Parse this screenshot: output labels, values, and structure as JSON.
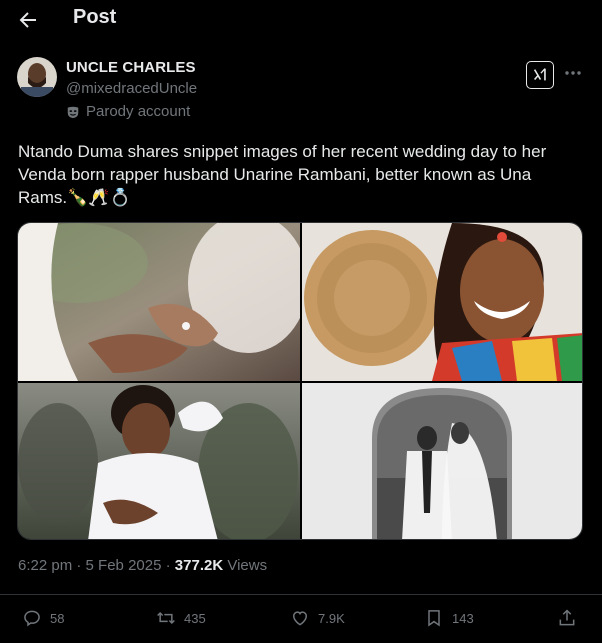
{
  "header": {
    "title": "Post",
    "back_icon": "arrow-left-icon"
  },
  "author": {
    "display_name": "UNCLE CHARLES",
    "handle": "@mixedracedUncle",
    "label": "Parody account",
    "label_icon": "mask-icon"
  },
  "tweet": {
    "lines": [
      "Ntando Duma shares snippet images of her recent wedding day to her",
      "Venda born rapper husband Unarine Rambani, better known as Una",
      "Rams.🍾🥂💍"
    ]
  },
  "media": {
    "images": [
      "wedding-ring-hands-photo",
      "bride-smiling-portrait-photo",
      "flower-girl-photo",
      "couple-arch-photo"
    ]
  },
  "meta": {
    "time": "6:22 pm",
    "separator": "·",
    "date": "5 Feb 2025",
    "views_count": "377.2K",
    "views_label": "Views"
  },
  "actions": {
    "replies": "58",
    "reposts": "435",
    "likes": "7.9K",
    "bookmarks": "143"
  },
  "colors": {
    "background": "#000000",
    "text": "#e7e9ea",
    "secondary": "#71767b",
    "border": "#2f3336"
  }
}
